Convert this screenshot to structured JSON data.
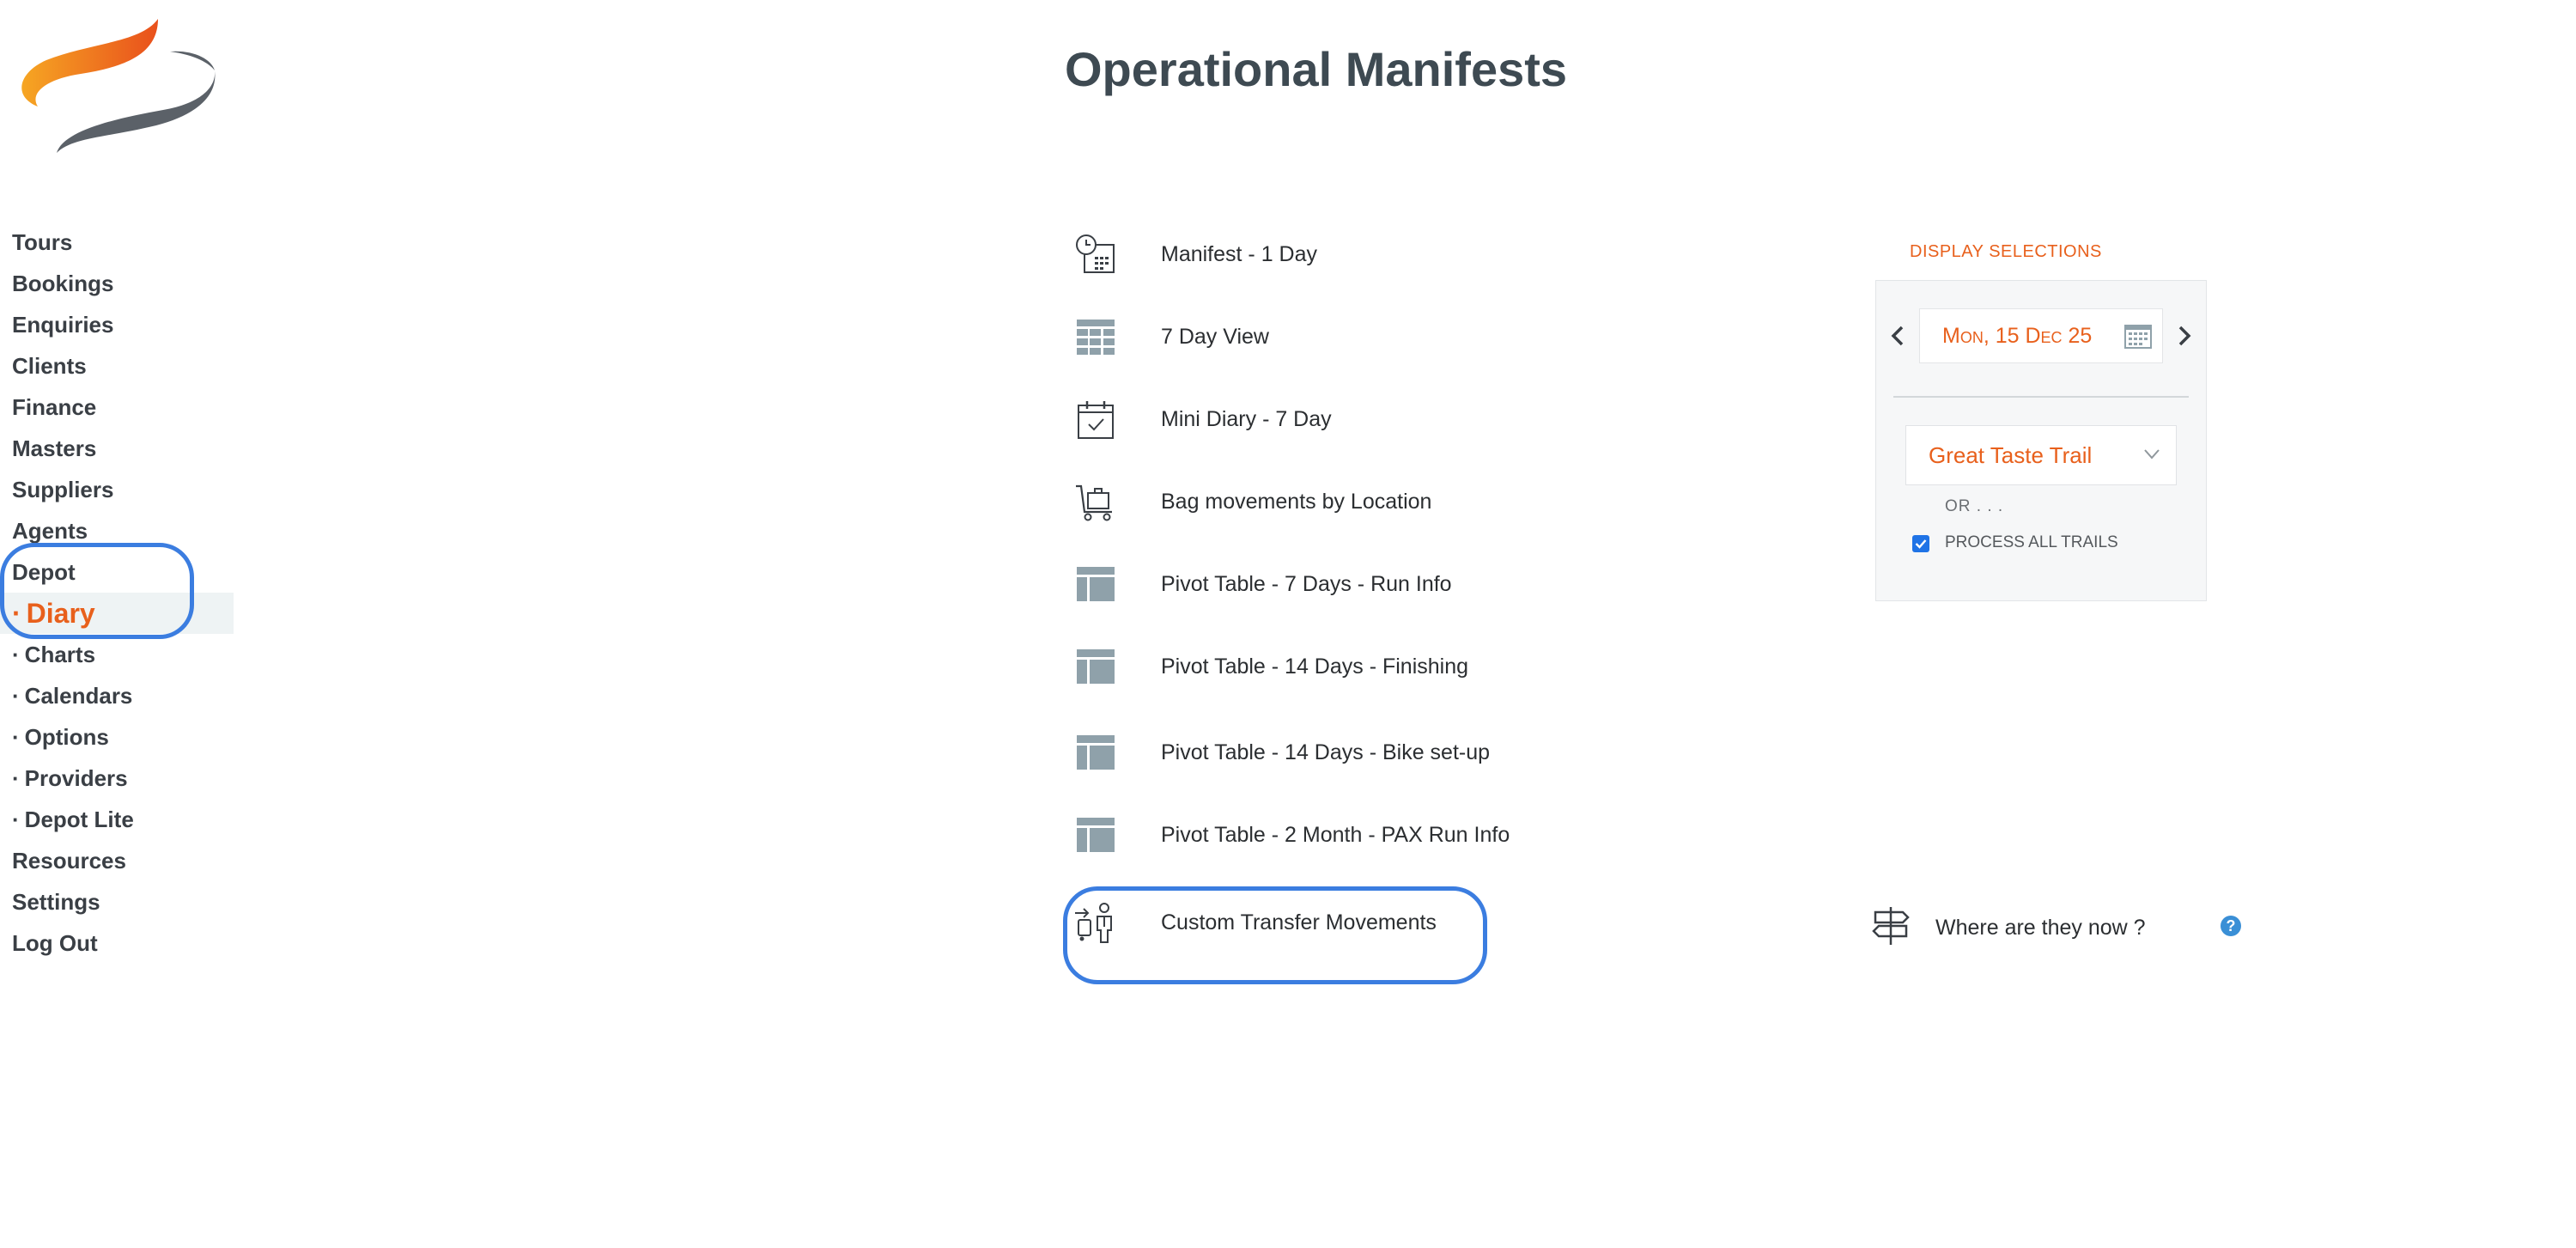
{
  "page": {
    "title": "Operational Manifests"
  },
  "sidebar": {
    "items": [
      {
        "label": "Tours",
        "sub": false
      },
      {
        "label": "Bookings",
        "sub": false
      },
      {
        "label": "Enquiries",
        "sub": false
      },
      {
        "label": "Clients",
        "sub": false
      },
      {
        "label": "Finance",
        "sub": false
      },
      {
        "label": "Masters",
        "sub": false
      },
      {
        "label": "Suppliers",
        "sub": false
      },
      {
        "label": "Agents",
        "sub": false
      },
      {
        "label": "Depot",
        "sub": false
      },
      {
        "label": "Diary",
        "sub": true,
        "active": true
      },
      {
        "label": "Charts",
        "sub": true
      },
      {
        "label": "Calendars",
        "sub": true
      },
      {
        "label": "Options",
        "sub": true
      },
      {
        "label": "Providers",
        "sub": true
      },
      {
        "label": "Depot Lite",
        "sub": true
      },
      {
        "label": "Resources",
        "sub": false
      },
      {
        "label": "Settings",
        "sub": false
      },
      {
        "label": "Log Out",
        "sub": false
      }
    ]
  },
  "manifests": [
    {
      "label": "Manifest - 1 Day",
      "icon": "calendar-clock-icon"
    },
    {
      "label": "7 Day View",
      "icon": "grid-table-icon"
    },
    {
      "label": "Mini Diary - 7 Day",
      "icon": "calendar-check-icon"
    },
    {
      "label": "Bag movements by Location",
      "icon": "luggage-cart-icon"
    },
    {
      "label": "Pivot Table - 7 Days - Run Info",
      "icon": "pivot-table-icon"
    },
    {
      "label": "Pivot Table - 14 Days - Finishing",
      "icon": "pivot-table-icon"
    },
    {
      "label": "Pivot Table - 14 Days - Bike set-up",
      "icon": "pivot-table-icon"
    },
    {
      "label": "Pivot Table - 2 Month - PAX Run Info",
      "icon": "pivot-table-icon"
    },
    {
      "label": "Custom Transfer Movements",
      "icon": "transfer-person-icon"
    }
  ],
  "selections": {
    "heading": "DISPLAY SELECTIONS",
    "date": "Mon, 15 Dec 25",
    "trail": "Great Taste Trail",
    "or_text": "OR . . .",
    "process_all_label": "PROCESS ALL TRAILS",
    "process_all_checked": true
  },
  "where": {
    "label": "Where are they now ?"
  },
  "colors": {
    "accent": "#e8601c",
    "highlight": "#3b7de0",
    "icon_gray": "#8fa1aa",
    "text": "#2f3338"
  }
}
